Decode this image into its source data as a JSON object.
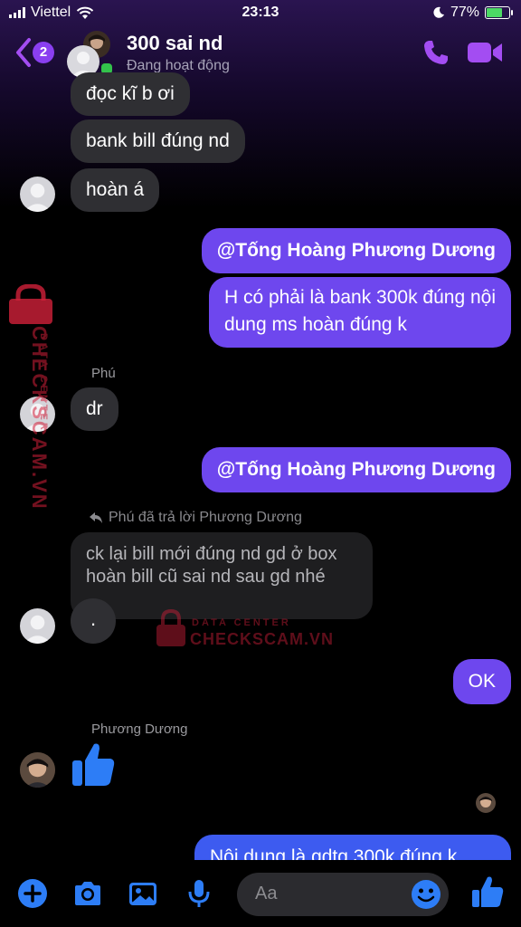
{
  "status_bar": {
    "carrier": "Viettel",
    "time": "23:13",
    "battery_text": "77%",
    "battery_level": 0.77
  },
  "header": {
    "unread_count": "2",
    "title": "300 sai nd",
    "subtitle": "Đang hoạt động",
    "accent": "#a34df2"
  },
  "messages": {
    "m1": "đọc kĩ b ơi",
    "m2": "bank bill đúng nd",
    "m3": "hoàn á",
    "m4": "@Tống Hoàng Phương Dương",
    "m5_line1": "H có phải là bank 300k đúng nội",
    "m5_line2": "dung ms hoàn đúng k",
    "sender_phu": "Phú",
    "m6": "dr",
    "m7": "@Tống Hoàng Phương Dương",
    "reply_label": "Phú đã trả lời Phương Dương",
    "quoted_line1": "ck lại bill mới đúng nd gd ở box",
    "quoted_line2": "hoàn bill cũ sai nd sau gd nhé",
    "m8": ".",
    "m9": "OK",
    "sender_duong": "Phương Dương",
    "m10": "Nội dung là gdtg 300k đúng k"
  },
  "composer": {
    "placeholder": "Aa"
  },
  "watermark": {
    "side_line1": "CHECKSCAM.VN",
    "side_line2": "DATA CENTER",
    "center_line1": "DATA CENTER",
    "center_line2": "CHECKSCAM.VN"
  },
  "colors": {
    "outgoing": "#6e47ee",
    "incoming": "#2f2f33",
    "icon_blue": "#2d7df6",
    "brand_red": "#d1203a"
  }
}
